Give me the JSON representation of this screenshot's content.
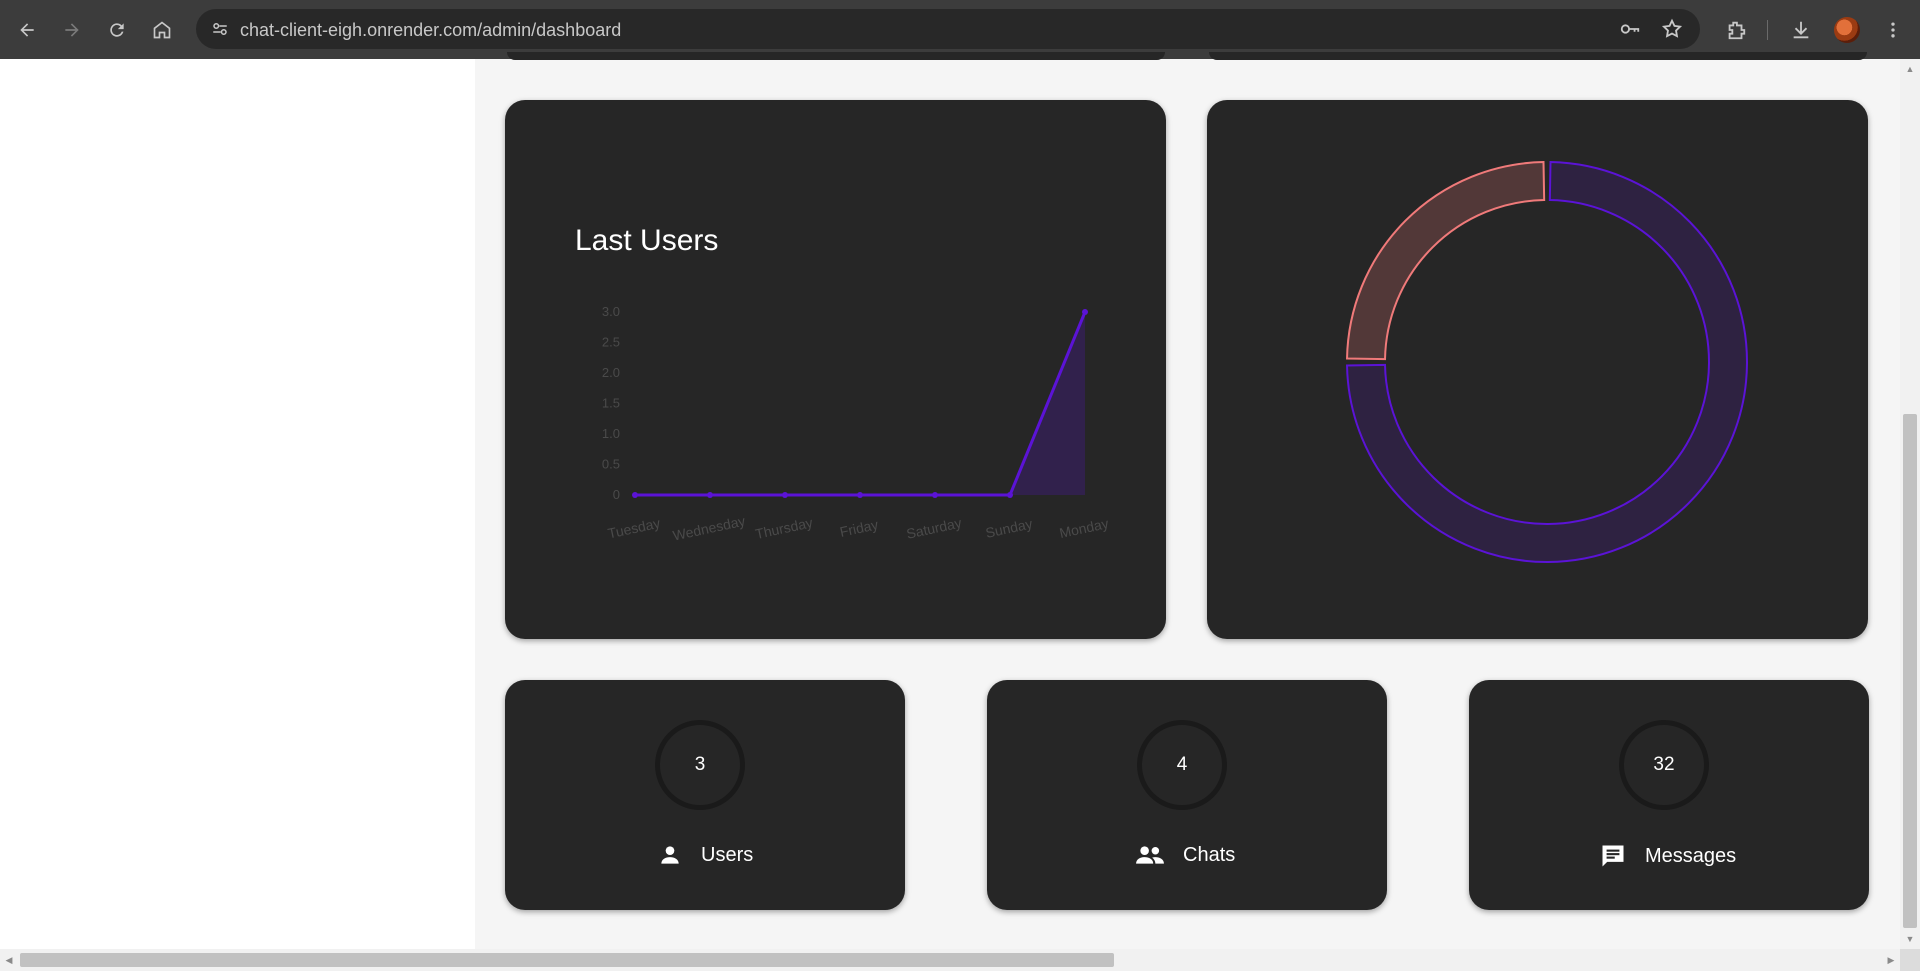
{
  "browser": {
    "url": "chat-client-eigh.onrender.com/admin/dashboard"
  },
  "colors": {
    "card_bg": "#262626",
    "line": "#5b13d6",
    "donut_primary": "#5b13d6",
    "donut_secondary": "#f07a7a"
  },
  "chart_data": [
    {
      "type": "line",
      "title": "Last Users",
      "categories": [
        "Tuesday",
        "Wednesday",
        "Thursday",
        "Friday",
        "Saturday",
        "Sunday",
        "Monday"
      ],
      "series": [
        {
          "values": [
            0,
            0,
            0,
            0,
            0,
            0,
            3
          ]
        }
      ],
      "ylim": [
        0,
        3
      ],
      "yticks": [
        "0",
        "0.5",
        "1.0",
        "1.5",
        "2.0",
        "2.5",
        "3.0"
      ],
      "filled": true
    },
    {
      "type": "pie",
      "style": "doughnut",
      "slices": [
        {
          "value": 75,
          "color": "#5b13d6"
        },
        {
          "value": 25,
          "color": "#f07a7a"
        }
      ]
    }
  ],
  "stats": [
    {
      "value": "3",
      "label": "Users",
      "icon": "person-icon"
    },
    {
      "value": "4",
      "label": "Chats",
      "icon": "people-icon"
    },
    {
      "value": "32",
      "label": "Messages",
      "icon": "message-icon"
    }
  ]
}
